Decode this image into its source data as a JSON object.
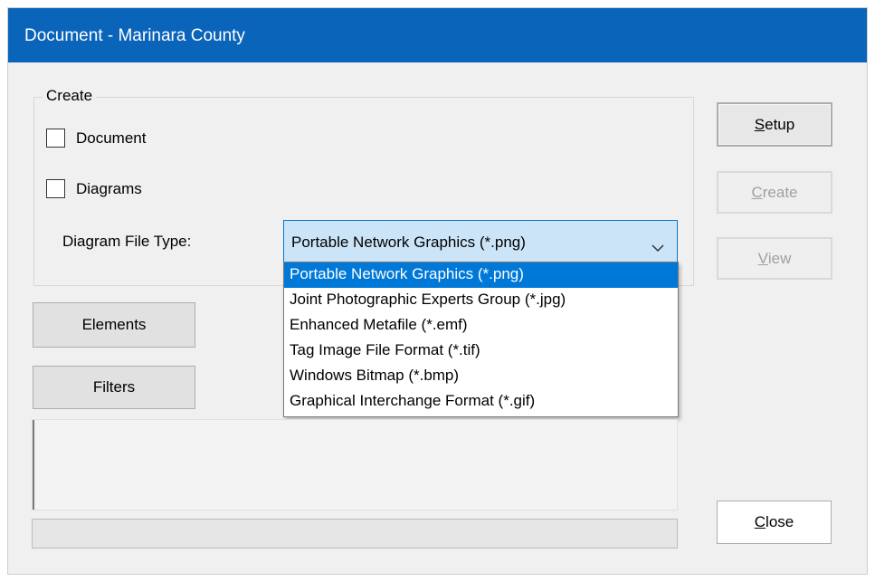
{
  "window": {
    "title": "Document - Marinara County"
  },
  "create_group": {
    "legend": "Create",
    "document_checkbox": {
      "label": "Document",
      "checked": false
    },
    "diagrams_checkbox": {
      "label": "Diagrams",
      "checked": false
    },
    "file_type_label": "Diagram File Type:",
    "file_type_value": "Portable Network Graphics (*.png)"
  },
  "file_type_options": [
    "Portable Network Graphics (*.png)",
    "Joint Photographic Experts Group (*.jpg)",
    "Enhanced Metafile (*.emf)",
    "Tag Image File Format (*.tif)",
    "Windows Bitmap (*.bmp)",
    "Graphical Interchange Format (*.gif)"
  ],
  "buttons": {
    "setup": {
      "first": "S",
      "rest": "etup"
    },
    "create": {
      "first": "C",
      "rest": "reate"
    },
    "view": {
      "first": "V",
      "rest": "iew"
    },
    "close": {
      "first": "C",
      "rest": "lose"
    },
    "elements": "Elements",
    "filters": "Filters"
  },
  "icons": {
    "dropdown_arrow": "chevron-down-icon"
  },
  "colors": {
    "titlebar": "#0a64ba",
    "selection": "#0078d7",
    "combo_focus": "#cce4f7"
  }
}
